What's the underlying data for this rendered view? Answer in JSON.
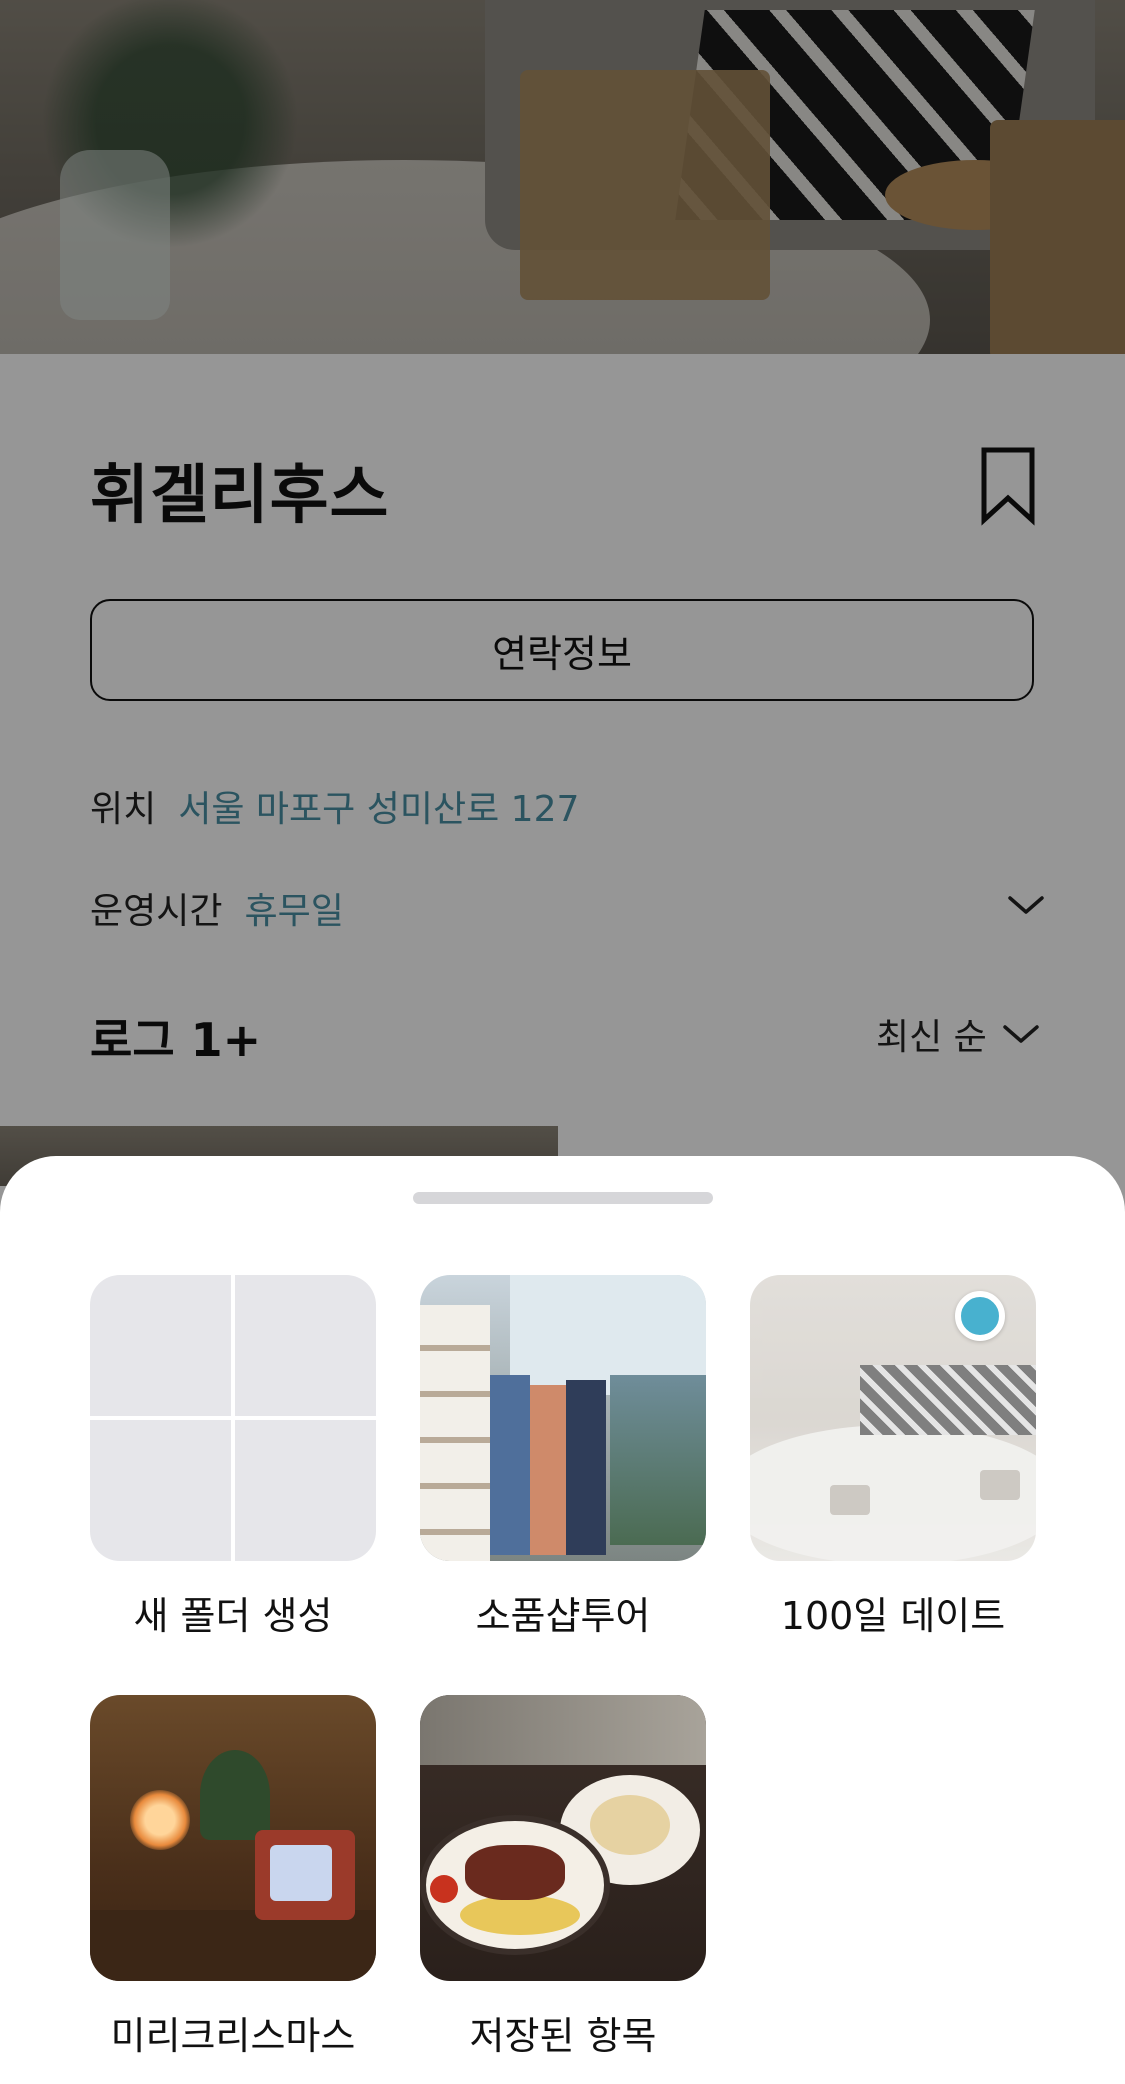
{
  "place": {
    "name": "휘겔리후스",
    "bookmark_icon": "bookmark-icon",
    "contact_button_label": "연락정보",
    "location_key": "위치",
    "location_value": "서울 마포구 성미산로 127",
    "hours_key": "운영시간",
    "hours_value": "휴무일"
  },
  "logs": {
    "title": "로그 1+",
    "sort_label": "최신 순"
  },
  "sheet": {
    "folders": [
      {
        "label": "새 폴더 생성",
        "type": "new-folder"
      },
      {
        "label": "소품샵투어",
        "type": "photo"
      },
      {
        "label": "100일 데이트",
        "type": "photo",
        "selected": true
      },
      {
        "label": "미리크리스마스",
        "type": "photo"
      },
      {
        "label": "저장된 항목",
        "type": "photo"
      }
    ]
  },
  "colors": {
    "accent_link": "#4a8fa3",
    "selected_dot": "#48b1cf",
    "overlay": "rgba(0,0,0,0.41)"
  }
}
